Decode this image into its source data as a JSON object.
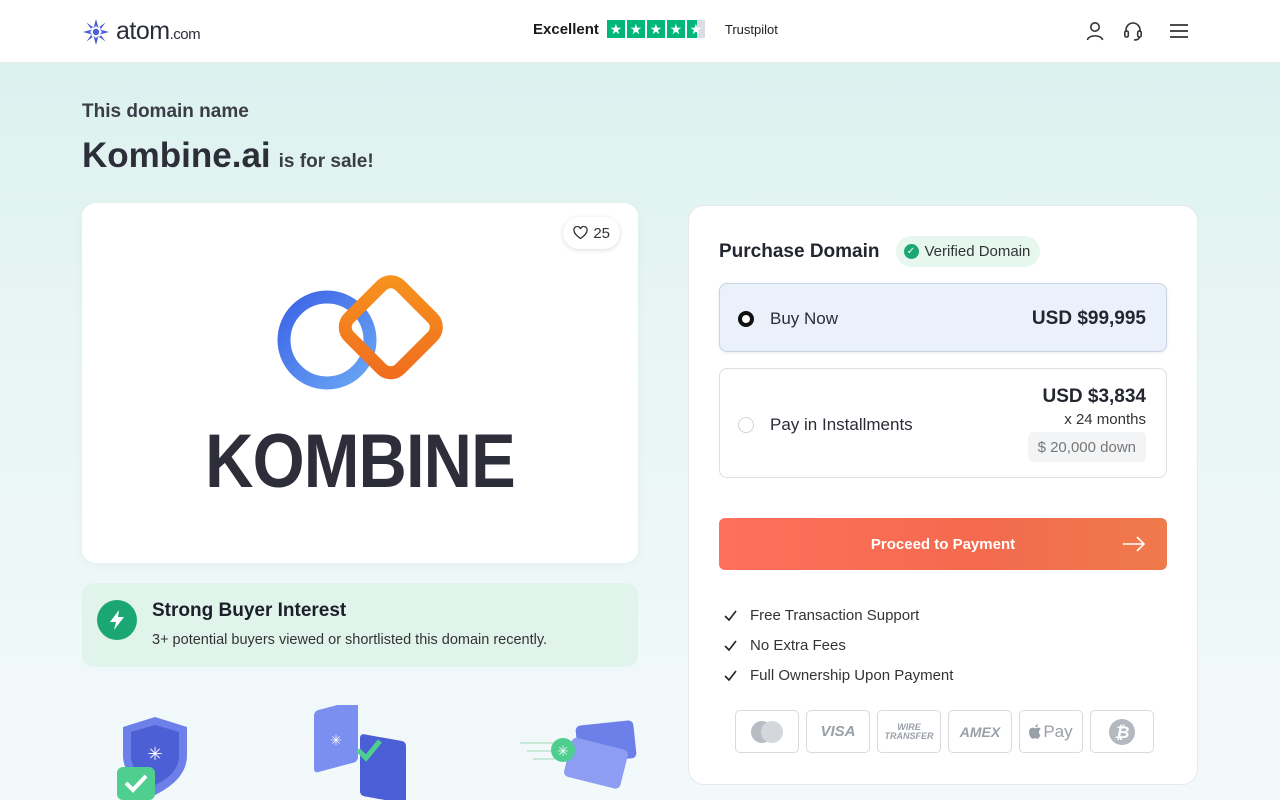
{
  "header": {
    "logo_main": "atom",
    "logo_suffix": ".com",
    "trust_label": "Excellent",
    "trust_brand": "Trustpilot",
    "trust_star_count": 4.5
  },
  "hero": {
    "subtitle": "This domain name",
    "domain": "Kombine.ai",
    "for_sale": "is for sale!"
  },
  "card": {
    "likes": "25",
    "brand_word": "KOMBINE"
  },
  "interest": {
    "title": "Strong Buyer Interest",
    "description": "3+ potential buyers viewed or shortlisted this domain recently."
  },
  "purchase": {
    "title": "Purchase Domain",
    "verified_label": "Verified Domain",
    "options": [
      {
        "label": "Buy Now",
        "price": "USD $99,995",
        "selected": true
      },
      {
        "label": "Pay in Installments",
        "price": "USD $3,834",
        "months": "x 24 months",
        "down": "$ 20,000 down",
        "selected": false
      }
    ],
    "cta": "Proceed to Payment",
    "features": [
      "Free Transaction Support",
      "No Extra Fees",
      "Full Ownership Upon Payment"
    ],
    "payment_methods": [
      "mastercard-icon",
      "VISA",
      "WIRE TRANSFER",
      "AMEX",
      "Pay",
      "bitcoin-icon"
    ]
  },
  "colors": {
    "accent_orange": "#f36a4e",
    "success_green": "#1aa775",
    "trustpilot_green": "#00b67a"
  }
}
